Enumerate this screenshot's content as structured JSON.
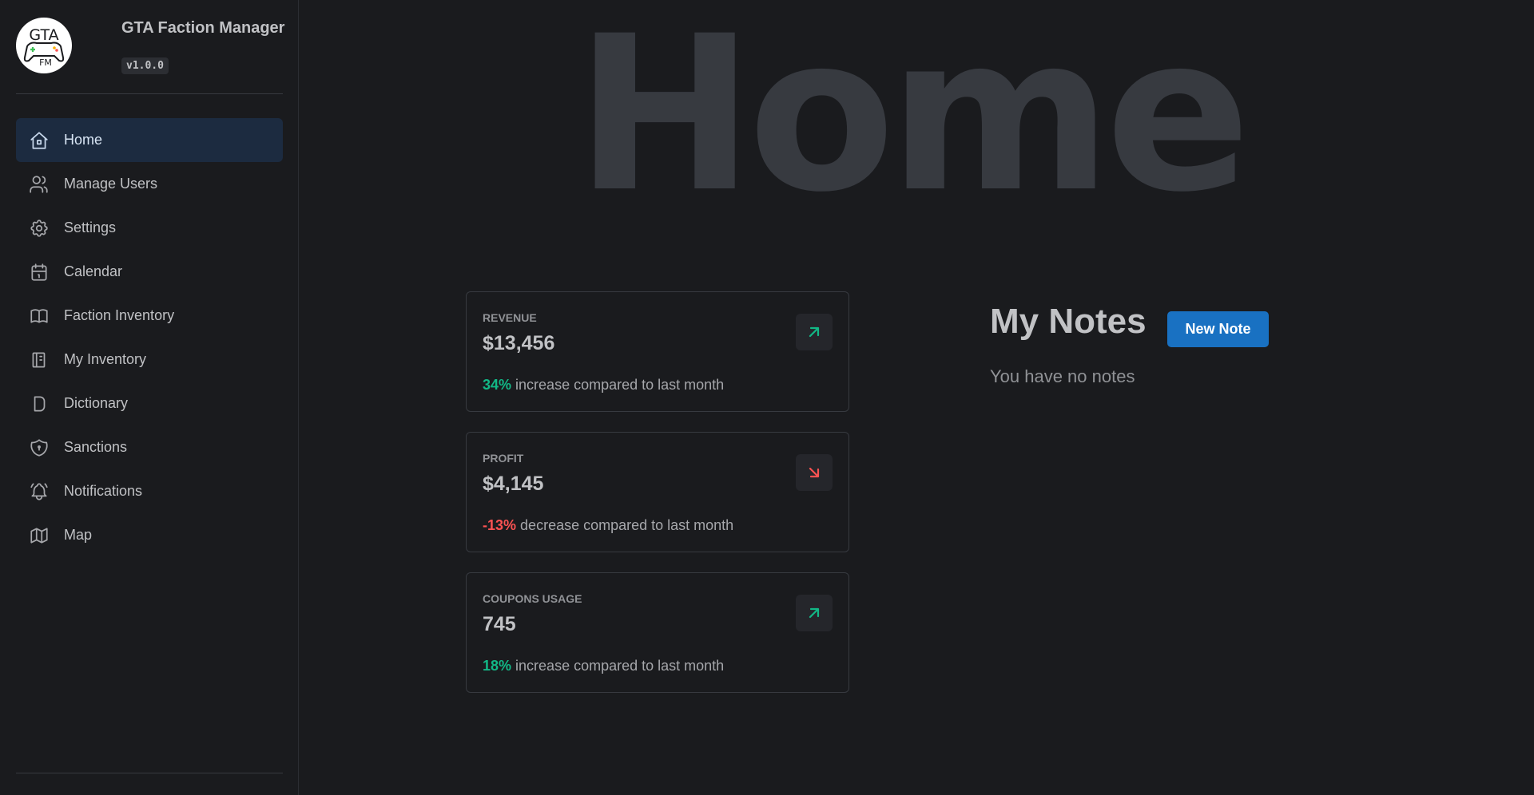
{
  "app": {
    "title": "GTA Faction Manager",
    "version": "v1.0.0",
    "logo_text_top": "GTA",
    "logo_text_bottom": "FM"
  },
  "sidebar": {
    "items": [
      {
        "label": "Home",
        "icon": "home-icon",
        "active": true
      },
      {
        "label": "Manage Users",
        "icon": "users-icon"
      },
      {
        "label": "Settings",
        "icon": "gear-icon"
      },
      {
        "label": "Calendar",
        "icon": "calendar-icon"
      },
      {
        "label": "Faction Inventory",
        "icon": "book-icon"
      },
      {
        "label": "My Inventory",
        "icon": "notebook-icon"
      },
      {
        "label": "Dictionary",
        "icon": "letter-d-icon"
      },
      {
        "label": "Sanctions",
        "icon": "shield-icon"
      },
      {
        "label": "Notifications",
        "icon": "bell-icon"
      },
      {
        "label": "Map",
        "icon": "map-icon"
      }
    ]
  },
  "main": {
    "hero_title": "Home",
    "stats": [
      {
        "label": "Revenue",
        "value": "$13,456",
        "diff": "34%",
        "direction": "up",
        "diff_text": "increase compared to last month"
      },
      {
        "label": "Profit",
        "value": "$4,145",
        "diff": "-13%",
        "direction": "down",
        "diff_text": "decrease compared to last month"
      },
      {
        "label": "Coupons usage",
        "value": "745",
        "diff": "18%",
        "direction": "up",
        "diff_text": "increase compared to last month"
      }
    ],
    "notes": {
      "title": "My Notes",
      "new_button": "New Note",
      "empty_text": "You have no notes"
    }
  },
  "colors": {
    "background": "#1a1b1e",
    "active_nav": "#1c2b40",
    "accent_blue": "#1971c2",
    "positive": "#12b886",
    "negative": "#fa5252"
  }
}
